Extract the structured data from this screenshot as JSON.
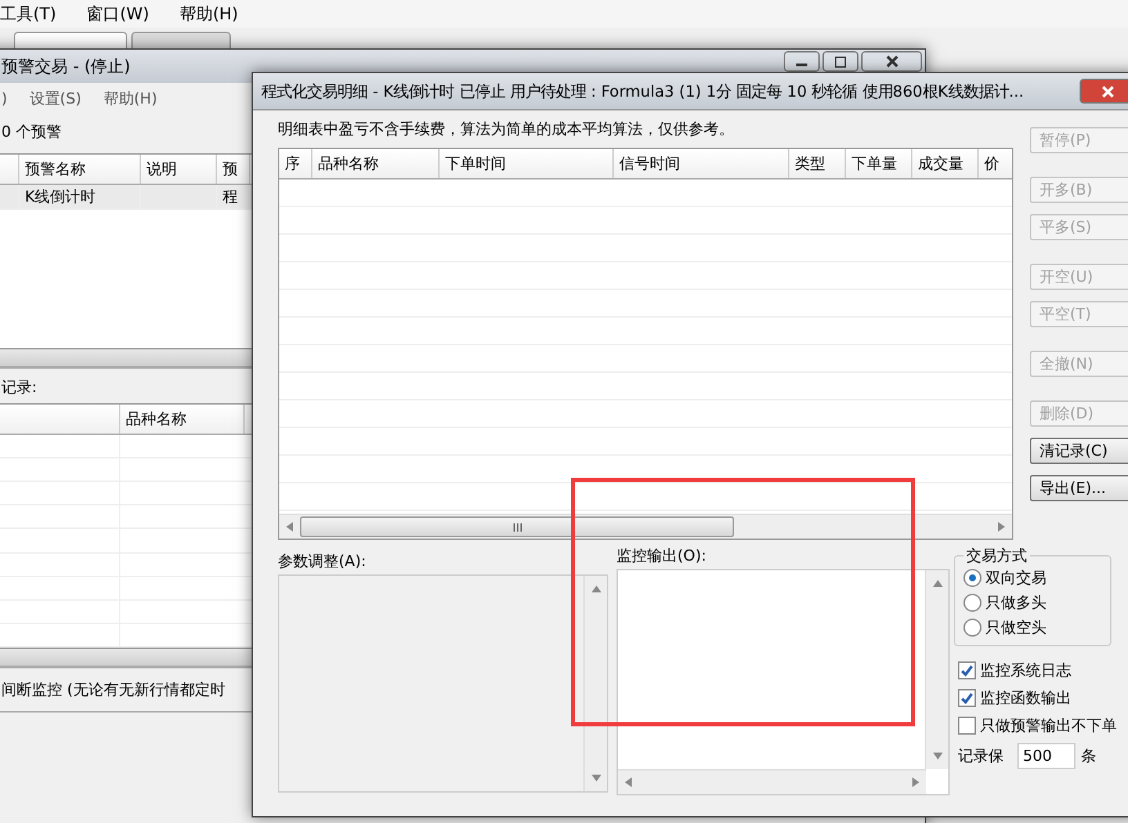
{
  "app": {
    "menu": [
      "工具(T)",
      "窗口(W)",
      "帮助(H)"
    ],
    "tabs": [
      {
        "selected": true
      },
      {
        "selected": false
      }
    ]
  },
  "back_window": {
    "title": "预警交易 - (停止)",
    "menu": [
      ")",
      "设置(S)",
      "帮助(H)"
    ],
    "count": "0 个预警",
    "alert_table": {
      "columns": [
        "预警名称",
        "说明",
        "预"
      ],
      "rows": [
        [
          "K线倒计时",
          "",
          "程"
        ]
      ]
    },
    "records_label": "记录:",
    "record_table": {
      "columns": [
        "品种名称"
      ]
    },
    "status": "间断监控 (无论有无新行情都定时"
  },
  "dialog": {
    "title": "程式化交易明细 - K线倒计时 已停止  用户待处理 : Formula3 (1) 1分 固定每 10 秒轮循 使用860根K线数据计...",
    "note": "明细表中盈亏不含手续费，算法为简单的成本平均算法，仅供参考。",
    "table": {
      "columns": [
        "序",
        "品种名称",
        "下单时间",
        "信号时间",
        "类型",
        "下单量",
        "成交量",
        "价"
      ]
    },
    "button_groups": [
      [
        {
          "label": "暂停(P)",
          "disabled": true
        }
      ],
      [
        {
          "label": "开多(B)",
          "disabled": true
        },
        {
          "label": "平多(S)",
          "disabled": true
        }
      ],
      [
        {
          "label": "开空(U)",
          "disabled": true
        },
        {
          "label": "平空(T)",
          "disabled": true
        }
      ],
      [
        {
          "label": "全撤(N)",
          "disabled": true
        }
      ],
      [
        {
          "label": "删除(D)",
          "disabled": true
        },
        {
          "label": "清记录(C)",
          "disabled": false
        },
        {
          "label": "导出(E)...",
          "disabled": false
        }
      ]
    ],
    "params_label": "参数调整(A):",
    "monitor_label": "监控输出(O):",
    "monitor_highlight": true,
    "trade_mode": {
      "title": "交易方式",
      "options": [
        {
          "label": "双向交易",
          "selected": true
        },
        {
          "label": "只做多头",
          "selected": false
        },
        {
          "label": "只做空头",
          "selected": false
        }
      ]
    },
    "checkboxes": [
      {
        "label": "监控系统日志",
        "checked": true
      },
      {
        "label": "监控函数输出",
        "checked": true
      },
      {
        "label": "只做预警输出不下单",
        "checked": false
      }
    ],
    "keep": {
      "label": "记录保",
      "value": "500",
      "unit": "条"
    }
  }
}
